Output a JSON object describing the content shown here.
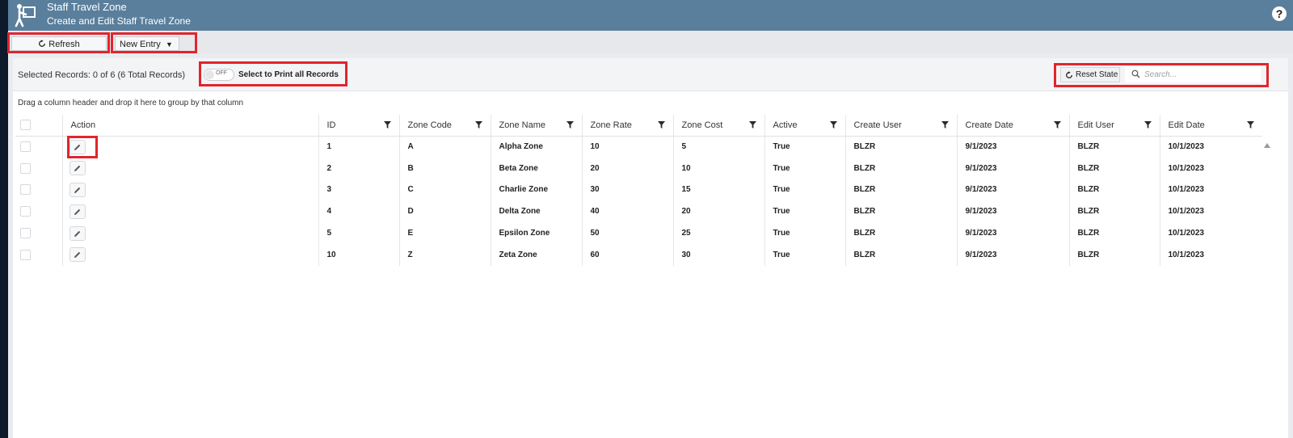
{
  "header": {
    "title": "Staff Travel Zone",
    "subtitle": "Create and Edit Staff Travel Zone",
    "help_label": "?"
  },
  "toolbar": {
    "refresh_label": "Refresh",
    "new_entry_label": "New Entry",
    "new_entry_caret": "▼"
  },
  "info_bar": {
    "selected_records": "Selected Records: 0 of 6 (6 Total Records)",
    "toggle_state": "OFF",
    "print_label": "Select to Print all Records",
    "reset_label": "Reset State",
    "search_placeholder": "Search..."
  },
  "group_hint": "Drag a column header and drop it here to group by that column",
  "grid": {
    "columns": [
      "Action",
      "ID",
      "Zone Code",
      "Zone Name",
      "Zone Rate",
      "Zone Cost",
      "Active",
      "Create User",
      "Create Date",
      "Edit User",
      "Edit Date"
    ],
    "rows": [
      [
        "1",
        "A",
        "Alpha Zone",
        "10",
        "5",
        "True",
        "BLZR",
        "9/1/2023",
        "BLZR",
        "10/1/2023"
      ],
      [
        "2",
        "B",
        "Beta Zone",
        "20",
        "10",
        "True",
        "BLZR",
        "9/1/2023",
        "BLZR",
        "10/1/2023"
      ],
      [
        "3",
        "C",
        "Charlie Zone",
        "30",
        "15",
        "True",
        "BLZR",
        "9/1/2023",
        "BLZR",
        "10/1/2023"
      ],
      [
        "4",
        "D",
        "Delta Zone",
        "40",
        "20",
        "True",
        "BLZR",
        "9/1/2023",
        "BLZR",
        "10/1/2023"
      ],
      [
        "5",
        "E",
        "Epsilon Zone",
        "50",
        "25",
        "True",
        "BLZR",
        "9/1/2023",
        "BLZR",
        "10/1/2023"
      ],
      [
        "10",
        "Z",
        "Zeta Zone",
        "60",
        "30",
        "True",
        "BLZR",
        "9/1/2023",
        "BLZR",
        "10/1/2023"
      ]
    ]
  },
  "colors": {
    "header_bg": "#5a7f9c",
    "highlight": "#e1252d"
  },
  "icons": {
    "logo": "person-door-icon",
    "help": "help-icon",
    "refresh": "refresh-icon",
    "search": "search-icon",
    "filter": "filter-icon",
    "edit": "pencil-icon"
  }
}
